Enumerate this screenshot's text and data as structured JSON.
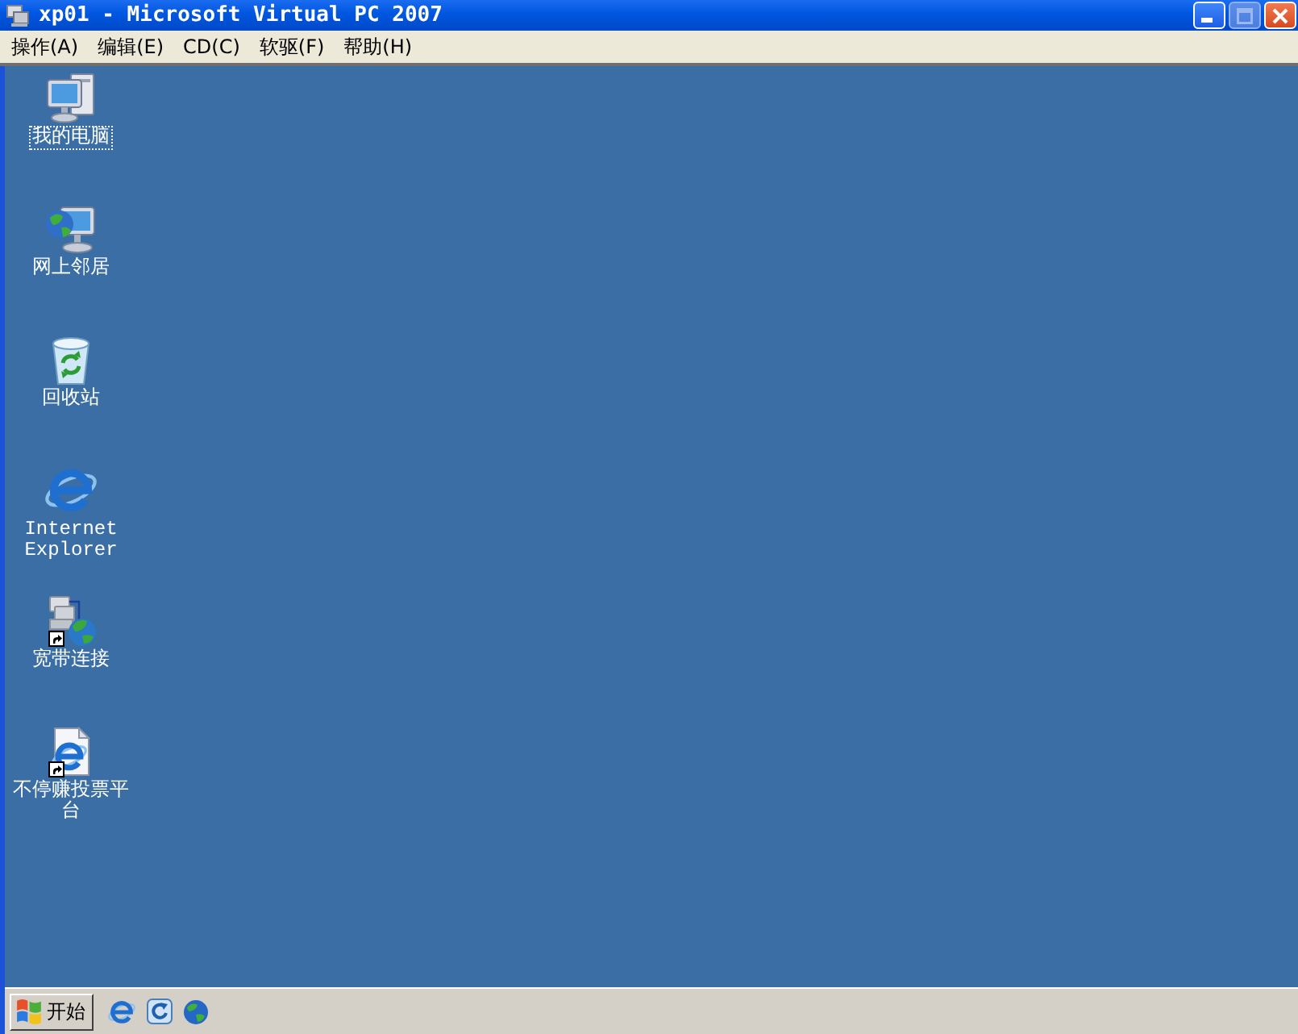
{
  "window": {
    "title": "xp01 - Microsoft Virtual PC 2007",
    "controls": [
      {
        "kind": "minimize",
        "disabled": false
      },
      {
        "kind": "maximize",
        "disabled": true
      },
      {
        "kind": "close",
        "disabled": false
      }
    ]
  },
  "menu": [
    "操作(A)",
    "编辑(E)",
    "CD(C)",
    "软驱(F)",
    "帮助(H)"
  ],
  "desktop": {
    "icons": [
      {
        "kind": "computer",
        "label": "我的电脑",
        "selected": true,
        "shortcut": false
      },
      {
        "kind": "network",
        "label": "网上邻居",
        "selected": false,
        "shortcut": false
      },
      {
        "kind": "recycle-bin",
        "label": "回收站",
        "selected": false,
        "shortcut": false
      },
      {
        "kind": "browser",
        "label": "Internet Explorer",
        "selected": false,
        "shortcut": false
      },
      {
        "kind": "connection",
        "label": "宽带连接",
        "selected": false,
        "shortcut": true
      },
      {
        "kind": "web-document",
        "label": "不停赚投票平台",
        "selected": false,
        "shortcut": true
      }
    ]
  },
  "taskbar": {
    "start_button": "开始",
    "quick_launch": [
      {
        "kind": "browser"
      },
      {
        "kind": "tile"
      },
      {
        "kind": "globe"
      }
    ]
  }
}
